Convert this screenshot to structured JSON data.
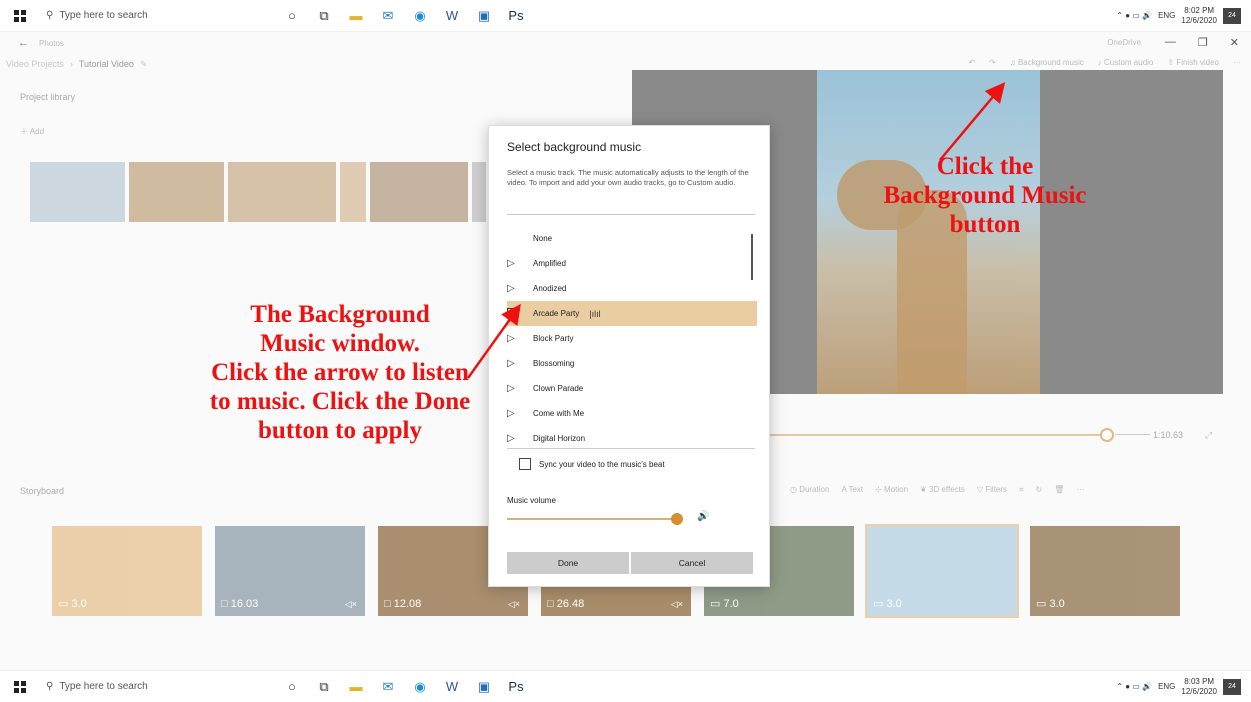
{
  "taskbar_top": {
    "search_placeholder": "Type here to search",
    "time": "8:02 PM",
    "date": "12/6/2020",
    "lang": "ENG",
    "notif_count": "24"
  },
  "taskbar_bottom": {
    "search_placeholder": "Type here to search",
    "time": "8:03 PM",
    "date": "12/6/2020",
    "lang": "ENG",
    "notif_count": "24"
  },
  "app": {
    "window_title": "Photos",
    "onedrive": "OneDrive",
    "breadcrumb_root": "Video Projects",
    "breadcrumb_current": "Tutorial Video",
    "toolbar": {
      "background_music": "Background music",
      "custom_audio": "Custom audio",
      "finish_video": "Finish video"
    },
    "library_title": "Project library",
    "add_label": "Add",
    "preview_time": "1:10.63",
    "storyboard_title": "Storyboard",
    "storyboard_tools": [
      "Duration",
      "Text",
      "Motion",
      "3D effects",
      "Filters"
    ],
    "clips": [
      {
        "duration": "3.0",
        "muted": false,
        "color": "#e9c89b"
      },
      {
        "duration": "16.03",
        "muted": true,
        "color": "#9aa8b3"
      },
      {
        "duration": "12.08",
        "muted": true,
        "color": "#9b7d57"
      },
      {
        "duration": "26.48",
        "muted": true,
        "color": "#9a7a52"
      },
      {
        "duration": "7.0",
        "muted": false,
        "color": "#7c8a72"
      },
      {
        "duration": "3.0",
        "muted": false,
        "color": "#bcd6e4"
      },
      {
        "duration": "3.0",
        "muted": false,
        "color": "#9b8260"
      }
    ]
  },
  "dialog": {
    "title": "Select background music",
    "description": "Select a music track. The music automatically adjusts to the length of the video. To import and add your own audio tracks, go to Custom audio.",
    "tracks": [
      "None",
      "Amplified",
      "Anodized",
      "Arcade Party",
      "Block Party",
      "Blossoming",
      "Clown Parade",
      "Come with Me",
      "Digital Horizon"
    ],
    "active_track": "Arcade Party",
    "sync_label": "Sync your video to the music's beat",
    "volume_label": "Music volume",
    "volume_level": 1.0,
    "done_label": "Done",
    "cancel_label": "Cancel"
  },
  "annotations": {
    "left_lines": [
      "The Background",
      "Music window.",
      "Click the arrow to listen",
      "to music. Click the Done",
      "button to apply"
    ],
    "right_lines": [
      "Click the",
      "Background Music",
      "button"
    ],
    "color": "#e11111"
  }
}
